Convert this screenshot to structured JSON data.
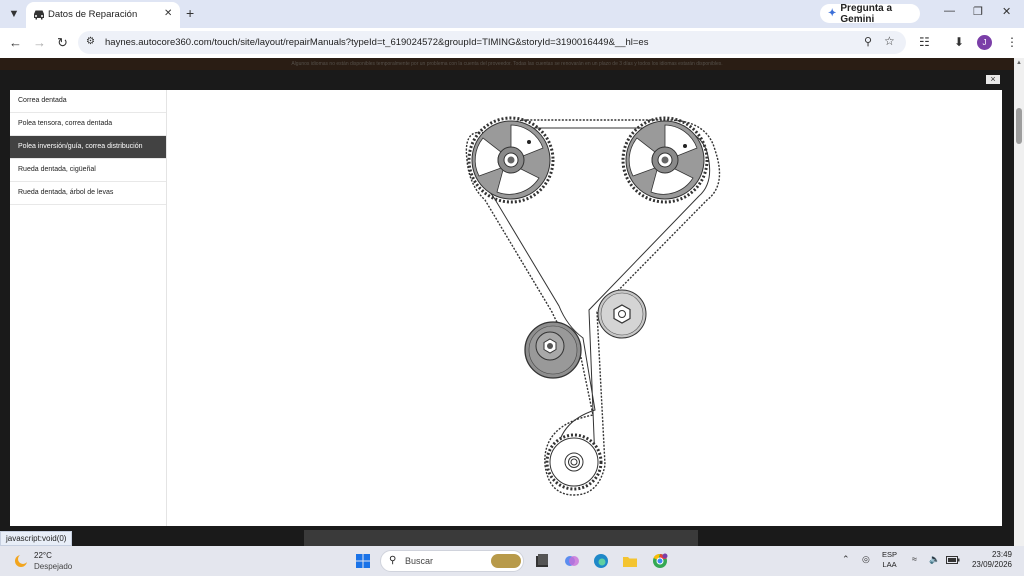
{
  "browser": {
    "tab_title": "Datos de Reparación",
    "new_tab": "+",
    "gemini_label": "Pregunta a Gemini",
    "url": "haynes.autocore360.com/touch/site/layout/repairManuals?typeId=t_619024572&groupId=TIMING&storyId=3190016449&__hl=es",
    "profile_initial": "J"
  },
  "page": {
    "notice": "Algunos idiomas no están disponibles temporalmente por un problema con la cuenta del proveedor. Todas las cuentas se renovarán en un plazo de 3 días y todos los idiomas estarán disponibles.",
    "modal_close": "×",
    "sidebar_items": [
      {
        "label": "Correa dentada",
        "active": false
      },
      {
        "label": "Polea tensora, correa dentada",
        "active": false
      },
      {
        "label": "Polea inversión/guía, correa distribución",
        "active": true
      },
      {
        "label": "Rueda dentada, cigüeñal",
        "active": false
      },
      {
        "label": "Rueda dentada, árbol de levas",
        "active": false
      }
    ]
  },
  "status_url": "javascript:void(0)",
  "taskbar": {
    "temperature": "22°C",
    "condition": "Despejado",
    "search_placeholder": "Buscar",
    "lang_top": "ESP",
    "lang_bottom": "LAA",
    "time": "23:49",
    "date": "23/09/2026"
  },
  "colors": {
    "active_item_bg": "#424242",
    "tabbar_bg": "#dfe5f4",
    "pulley_fill": "#8e8e8e"
  },
  "icons": [
    "car-icon",
    "close-icon",
    "sparkle-icon",
    "minimize-icon",
    "maximize-icon",
    "back-icon",
    "forward-icon",
    "reload-icon",
    "tune-icon",
    "zoom-icon",
    "star-icon",
    "extensions-icon",
    "download-icon",
    "windows-icon",
    "search-icon",
    "wifi-icon",
    "volume-icon",
    "battery-icon",
    "sun-icon"
  ]
}
